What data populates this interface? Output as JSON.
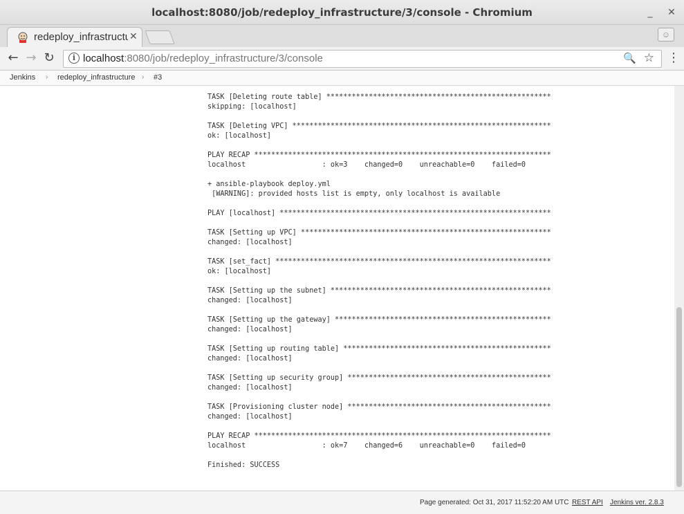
{
  "window": {
    "title": "localhost:8080/job/redeploy_infrastructure/3/console - Chromium",
    "minimize_icon": "minimize-icon",
    "close_icon": "close-icon"
  },
  "tab": {
    "title": "redeploy_infrastructure",
    "favicon": "jenkins-icon",
    "close_icon": "close-icon"
  },
  "toolbar": {
    "url_host": "localhost",
    "url_rest": ":8080/job/redeploy_infrastructure/3/console",
    "back_icon": "back-arrow-icon",
    "forward_icon": "forward-arrow-icon",
    "reload_icon": "reload-icon"
  },
  "breadcrumbs": [
    "Jenkins",
    "redeploy_infrastructure",
    "#3"
  ],
  "console_lines": [
    "TASK [Deleting route table] *****************************************************",
    "skipping: [localhost]",
    "",
    "TASK [Deleting VPC] *************************************************************",
    "ok: [localhost]",
    "",
    "PLAY RECAP **********************************************************************",
    "localhost                  : ok=3    changed=0    unreachable=0    failed=0   ",
    "",
    "+ ansible-playbook deploy.yml",
    " [WARNING]: provided hosts list is empty, only localhost is available",
    "",
    "PLAY [localhost] ****************************************************************",
    "",
    "TASK [Setting up VPC] ***********************************************************",
    "changed: [localhost]",
    "",
    "TASK [set_fact] *****************************************************************",
    "ok: [localhost]",
    "",
    "TASK [Setting up the subnet] ****************************************************",
    "changed: [localhost]",
    "",
    "TASK [Setting up the gateway] ***************************************************",
    "changed: [localhost]",
    "",
    "TASK [Setting up routing table] *************************************************",
    "changed: [localhost]",
    "",
    "TASK [Setting up security group] ************************************************",
    "changed: [localhost]",
    "",
    "TASK [Provisioning cluster node] ************************************************",
    "changed: [localhost]",
    "",
    "PLAY RECAP **********************************************************************",
    "localhost                  : ok=7    changed=6    unreachable=0    failed=0   ",
    "",
    "Finished: SUCCESS"
  ],
  "footer": {
    "page_generated": "Page generated: Oct 31, 2017 11:52:20 AM UTC",
    "rest_api": "REST API",
    "jenkins_ver": "Jenkins ver. 2.8.3"
  }
}
